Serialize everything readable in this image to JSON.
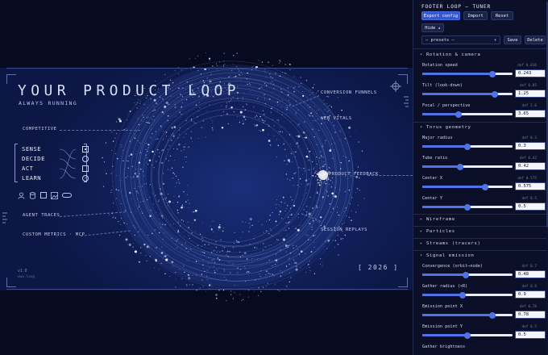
{
  "stage": {
    "title": "YOUR PRODUCT LOOP",
    "subtitle": "ALWAYS RUNNING",
    "annotations": {
      "competitive": "COMPETITIVE",
      "conversion_funnels": "CONVERSION FUNNELS",
      "web_vitals": "WEB VITALS",
      "product_feedback": "PRODUCT FEEDBACK",
      "agent_traces": "AGENT TRACES",
      "custom_metrics": "CUSTOM METRICS · MCP",
      "session_replays": "SESSION REPLAYS"
    },
    "loop_steps": [
      "SENSE",
      "DECIDE",
      "ACT",
      "LEARN"
    ],
    "loop_step_icons": [
      "square-dot-icon",
      "circle-icon",
      "square-icon",
      "check-circle-icon"
    ],
    "bottom_icons": [
      "user-icon",
      "database-icon",
      "window-icon",
      "image-icon",
      "pill-icon"
    ],
    "year": "[ 2026 ]",
    "version": "v1.0",
    "version_sub": "www.loop"
  },
  "panel": {
    "title": "FOOTER LOOP — TUNER",
    "buttons": {
      "export": "Export config",
      "import": "Import",
      "reset": "Reset",
      "hide": "Hide ▴",
      "save": "Save",
      "delete": "Delete"
    },
    "presets_value": "— presets —",
    "sections": {
      "rotation": "Rotation & camera",
      "torus": "Torus geometry",
      "wireframe": "Wireframe",
      "particles": "Particles",
      "streams": "Streams (tracers)",
      "signal": "Signal emission"
    },
    "sliders": {
      "rotation_speed": {
        "label": "Rotation speed",
        "def": "def 0.016",
        "value": "0.243",
        "pct": 0.78
      },
      "tilt": {
        "label": "Tilt (look-down)",
        "def": "def 0.85",
        "value": "1.25",
        "pct": 0.8
      },
      "focal": {
        "label": "Focal / perspective",
        "def": "def 2.6",
        "value": "3.65",
        "pct": 0.4
      },
      "major_radius": {
        "label": "Major radius",
        "def": "def 0.3",
        "value": "0.3",
        "pct": 0.5
      },
      "tube_ratio": {
        "label": "Tube ratio",
        "def": "def 0.42",
        "value": "0.42",
        "pct": 0.42
      },
      "center_x": {
        "label": "Center X",
        "def": "def 0.575",
        "value": "0.575",
        "pct": 0.7
      },
      "center_y": {
        "label": "Center Y",
        "def": "def 0.5",
        "value": "0.5",
        "pct": 0.5
      },
      "convergence": {
        "label": "Convergence (orbit→node)",
        "def": "def 0.7",
        "value": "0.48",
        "pct": 0.48
      },
      "gather_radius": {
        "label": "Gather radius (×R)",
        "def": "def 0.9",
        "value": "0.9",
        "pct": 0.45
      },
      "emission_x": {
        "label": "Emission point X",
        "def": "def 0.78",
        "value": "0.78",
        "pct": 0.78
      },
      "emission_y": {
        "label": "Emission point Y",
        "def": "def 0.5",
        "value": "0.5",
        "pct": 0.5
      },
      "gather_brightness": {
        "label": "Gather brightness"
      }
    }
  }
}
